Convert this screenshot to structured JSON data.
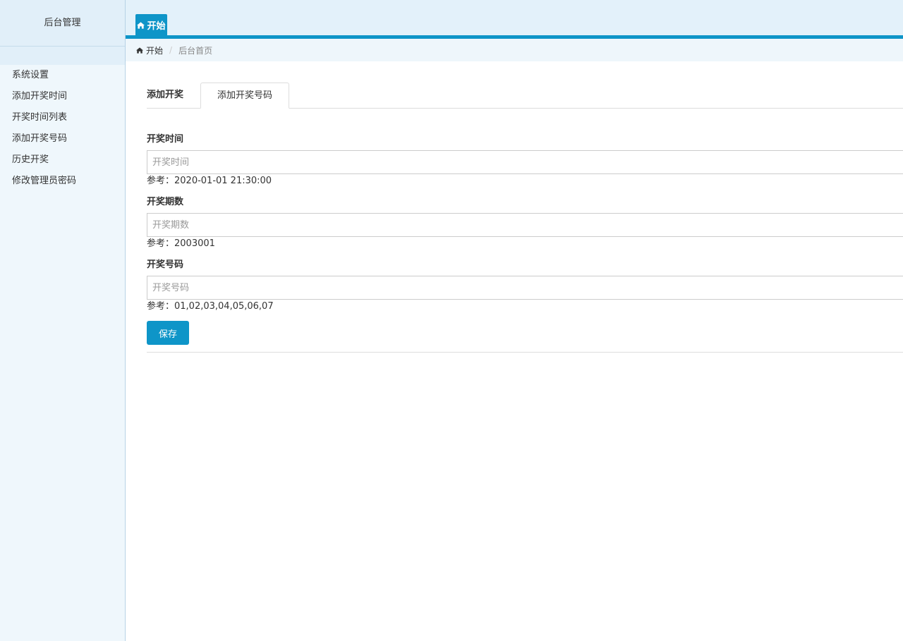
{
  "sidebar": {
    "brand": "后台管理",
    "items": [
      {
        "label": "系统设置"
      },
      {
        "label": "添加开奖时间"
      },
      {
        "label": "开奖时间列表"
      },
      {
        "label": "添加开奖号码"
      },
      {
        "label": "历史开奖"
      },
      {
        "label": "修改管理员密码"
      }
    ]
  },
  "header": {
    "tab_label": "开始",
    "tab_icon": "home-icon",
    "accent_color": "#0e95c8"
  },
  "breadcrumb": {
    "home_label": "开始",
    "separator": "/",
    "current": "后台首页"
  },
  "main": {
    "tabs": [
      {
        "label": "添加开奖"
      },
      {
        "label": "添加开奖号码"
      }
    ],
    "form": {
      "draw_time": {
        "label": "开奖时间",
        "value": "",
        "placeholder": "开奖时间",
        "hint": "参考：2020-01-01 21:30:00"
      },
      "draw_period": {
        "label": "开奖期数",
        "value": "",
        "placeholder": "开奖期数",
        "hint": "参考：2003001"
      },
      "draw_number": {
        "label": "开奖号码",
        "value": "",
        "placeholder": "开奖号码",
        "hint": "参考：01,02,03,04,05,06,07"
      },
      "save_label": "保存"
    }
  }
}
